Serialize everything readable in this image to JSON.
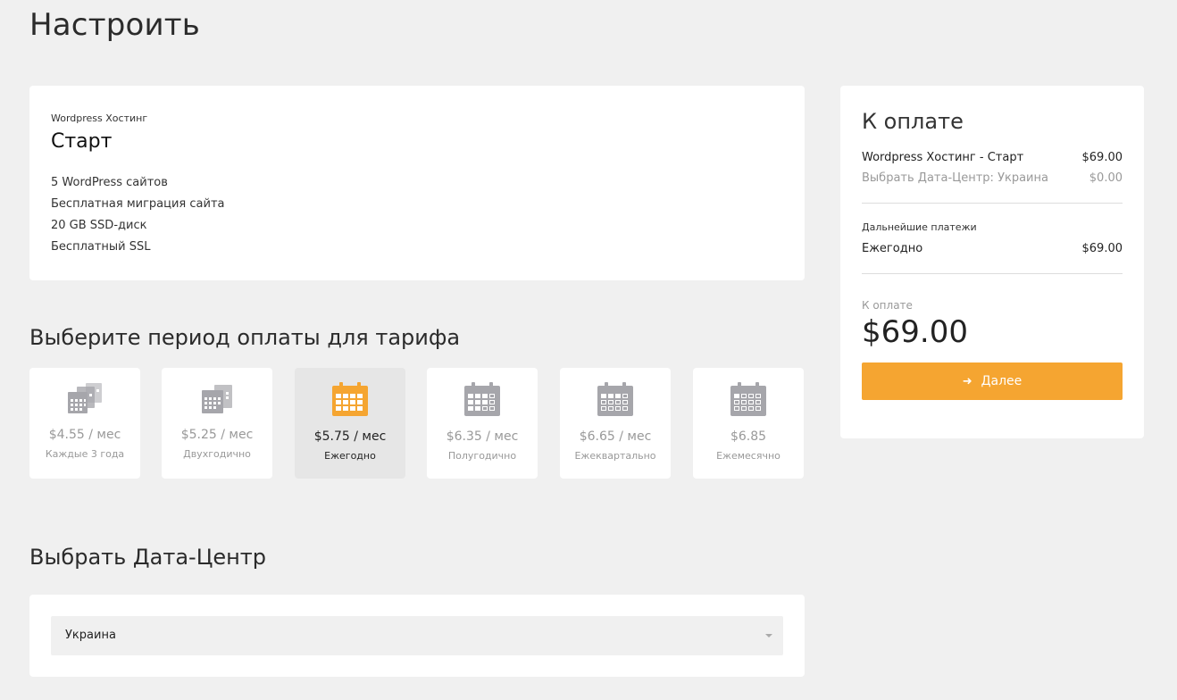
{
  "page": {
    "title": "Настроить"
  },
  "product": {
    "group": "Wordpress Хостинг",
    "name": "Старт",
    "features": [
      "5 WordPress сайтов",
      "Бесплатная миграция сайта",
      "20 GB SSD-диск",
      "Бесплатный SSL"
    ]
  },
  "billing": {
    "title": "Выберите период оплаты для тарифа",
    "cycles": [
      {
        "price": "$4.55 / мес",
        "label": "Каждые 3 года",
        "icon": "triple-calendar-icon",
        "active": false
      },
      {
        "price": "$5.25 / мес",
        "label": "Двухгодично",
        "icon": "double-calendar-icon",
        "active": false
      },
      {
        "price": "$5.75 / мес",
        "label": "Ежегодно",
        "icon": "calendar-full-icon",
        "active": true
      },
      {
        "price": "$6.35 / мес",
        "label": "Полугодично",
        "icon": "calendar-half-icon",
        "active": false
      },
      {
        "price": "$6.65 / мес",
        "label": "Ежеквартально",
        "icon": "calendar-quarter-icon",
        "active": false
      },
      {
        "price": "$6.85",
        "label": "Ежемесячно",
        "icon": "calendar-month-icon",
        "active": false
      }
    ]
  },
  "datacenter": {
    "title": "Выбрать Дата-Центр",
    "selected": "Украина"
  },
  "summary": {
    "title": "К оплате",
    "product_line": {
      "label": "Wordpress Хостинг - Старт",
      "amount": "$69.00"
    },
    "option_line": {
      "label": "Выбрать Дата-Центр: Украина",
      "amount": "$0.00"
    },
    "recurring_title": "Дальнейшие платежи",
    "recurring_line": {
      "label": "Ежегодно",
      "amount": "$69.00"
    },
    "total_label": "К оплате",
    "total_amount": "$69.00",
    "checkout_label": "Далее"
  },
  "colors": {
    "accent": "#f5a531",
    "icon_inactive": "#a6a6ab",
    "background": "#f0f0f0"
  }
}
